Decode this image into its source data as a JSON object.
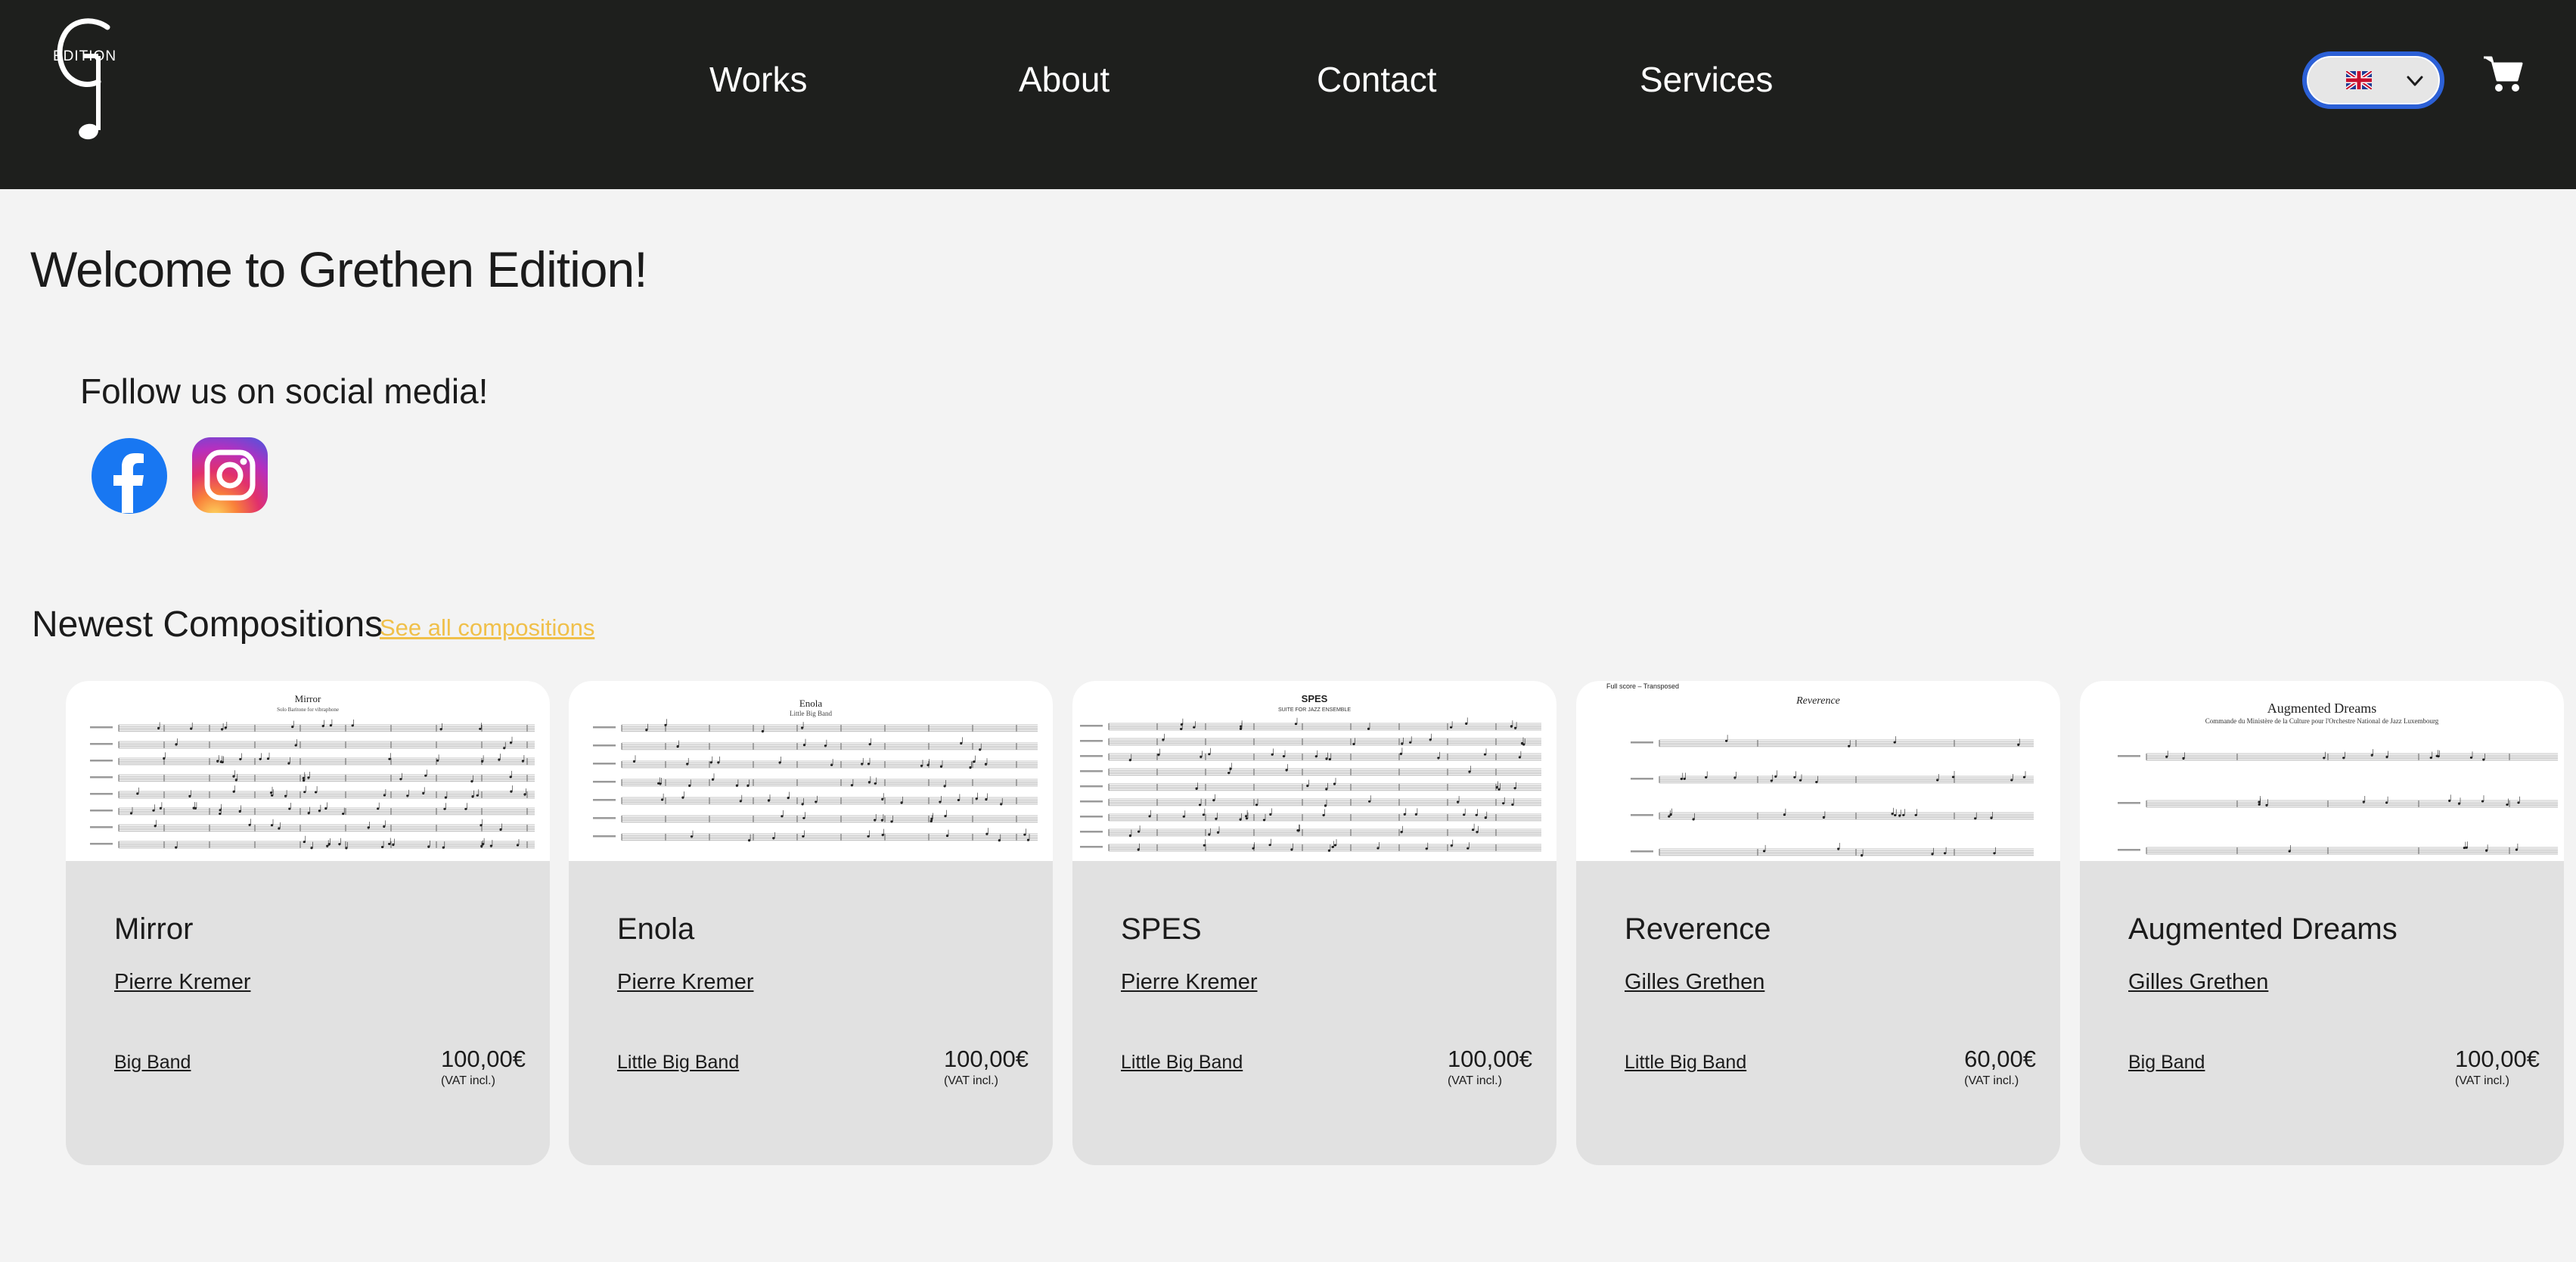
{
  "brand": {
    "logo_text": "EDITION"
  },
  "nav": {
    "items": [
      {
        "label": "Works"
      },
      {
        "label": "About"
      },
      {
        "label": "Contact"
      },
      {
        "label": "Services"
      }
    ]
  },
  "language": {
    "flag": "uk-flag-icon",
    "chevron": "chevron-down-icon",
    "accent_border": "#2c60d6"
  },
  "cart": {
    "icon": "cart-icon"
  },
  "main": {
    "welcome": "Welcome to Grethen Edition!",
    "follow": "Follow us on social media!",
    "social": [
      {
        "icon": "facebook-icon",
        "color": "#1877f2"
      },
      {
        "icon": "instagram-icon"
      }
    ],
    "newest_title": "Newest Compositions",
    "see_all": "See all compositions",
    "accent_link": "#f0c04a"
  },
  "cards": [
    {
      "title": "Mirror",
      "composer": "Pierre Kremer",
      "ensemble": "Big Band",
      "price": "100,00€",
      "vat": "(VAT incl.)",
      "score_title": "Mirror",
      "score_subtitle": "Solo Baritone for vibraphone"
    },
    {
      "title": "Enola",
      "composer": "Pierre Kremer",
      "ensemble": "Little Big Band",
      "price": "100,00€",
      "vat": "(VAT incl.)",
      "score_title": "Enola",
      "score_subtitle": "Little Big Band"
    },
    {
      "title": "SPES",
      "composer": "Pierre Kremer",
      "ensemble": "Little Big Band",
      "price": "100,00€",
      "vat": "(VAT incl.)",
      "score_title": "SPES",
      "score_subtitle": "SUITE FOR JAZZ ENSEMBLE"
    },
    {
      "title": "Reverence",
      "composer": "Gilles Grethen",
      "ensemble": "Little Big Band",
      "price": "60,00€",
      "vat": "(VAT incl.)",
      "score_title": "Reverence",
      "score_subtitle": "Full score – Transposed"
    },
    {
      "title": "Augmented Dreams",
      "composer": "Gilles Grethen",
      "ensemble": "Big Band",
      "price": "100,00€",
      "vat": "(VAT incl.)",
      "score_title": "Augmented Dreams",
      "score_subtitle": "Commande du Ministère de la Culture pour l'Orchestre National de Jazz Luxembourg"
    }
  ]
}
